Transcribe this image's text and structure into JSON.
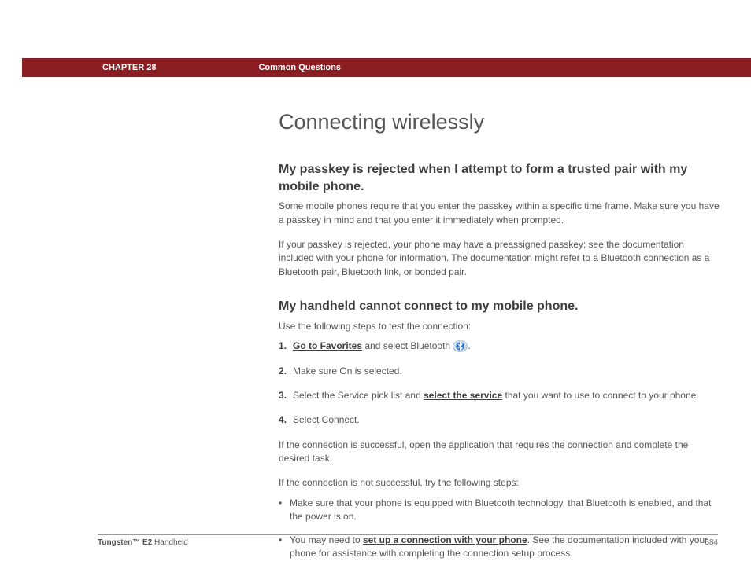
{
  "header": {
    "chapter_label": "CHAPTER 28",
    "section_label": "Common Questions"
  },
  "title": "Connecting wirelessly",
  "q1": {
    "heading": "My passkey is rejected when I attempt to form a trusted pair with my mobile phone.",
    "p1": "Some mobile phones require that you enter the passkey within a specific time frame. Make sure you have a passkey in mind and that you enter it immediately when prompted.",
    "p2": "If your passkey is rejected, your phone may have a preassigned passkey; see the documentation included with your phone for information. The documentation might refer to a Bluetooth connection as a Bluetooth pair, Bluetooth link, or bonded pair."
  },
  "q2": {
    "heading": "My handheld cannot connect to my mobile phone.",
    "intro": "Use the following steps to test the connection:",
    "step1_link": "Go to Favorites",
    "step1_rest": " and select Bluetooth ",
    "step1_period": ".",
    "step2": "Make sure On is selected.",
    "step3_pre": "Select the Service pick list and ",
    "step3_link": "select the service",
    "step3_post": " that you want to use to connect to your phone.",
    "step4": "Select Connect.",
    "after_success": "If the connection is successful, open the application that requires the connection and complete the desired task.",
    "after_fail_intro": "If the connection is not successful, try the following steps:",
    "bullet1": "Make sure that your phone is equipped with Bluetooth technology, that Bluetooth is enabled, and that the power is on.",
    "bullet2_pre": "You may need to ",
    "bullet2_link": "set up a connection with your phone",
    "bullet2_post": ". See the documentation included with your phone for assistance with completing the connection setup process."
  },
  "footer": {
    "product_bold": "Tungsten™ E2",
    "product_rest": " Handheld",
    "page": "584"
  }
}
